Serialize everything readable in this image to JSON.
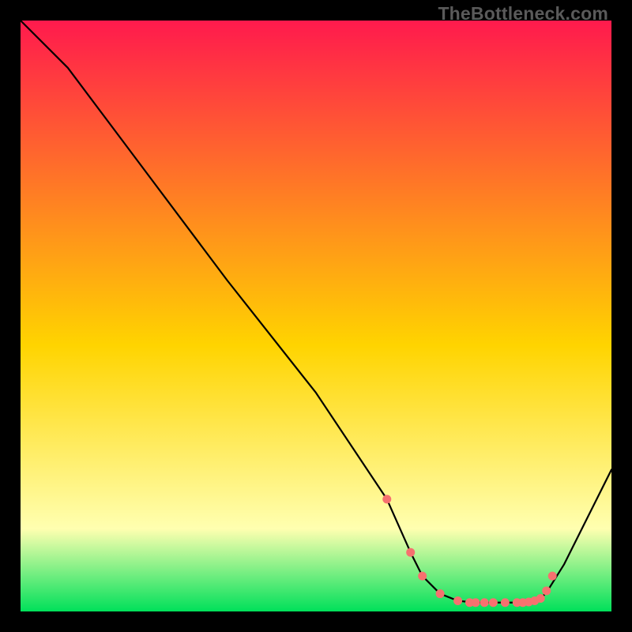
{
  "watermark": "TheBottleneck.com",
  "colors": {
    "gradient_top": "#ff1a4d",
    "gradient_mid": "#ffd400",
    "gradient_low": "#ffffb0",
    "gradient_bottom": "#00e05a",
    "line": "#000000",
    "marker": "#f6716f"
  },
  "chart_data": {
    "type": "line",
    "title": "",
    "xlabel": "",
    "ylabel": "",
    "xlim": [
      0,
      100
    ],
    "ylim": [
      0,
      100
    ],
    "x": [
      0,
      8,
      20,
      35,
      50,
      62,
      66,
      68,
      71,
      74,
      77,
      80,
      82,
      85,
      87,
      88,
      89.5,
      92,
      95,
      100
    ],
    "values": [
      100,
      92,
      76,
      56,
      37,
      19,
      10,
      6,
      3,
      1.8,
      1.5,
      1.5,
      1.5,
      1.5,
      1.5,
      2,
      4,
      8,
      14,
      24
    ],
    "markers_x": [
      62,
      66,
      68,
      71,
      74,
      76,
      77,
      78.5,
      80,
      82,
      84,
      85,
      86,
      87,
      88,
      89,
      90
    ],
    "markers_y": [
      19,
      10,
      6,
      3,
      1.8,
      1.5,
      1.5,
      1.5,
      1.5,
      1.5,
      1.5,
      1.5,
      1.6,
      1.8,
      2.2,
      3.5,
      6
    ]
  }
}
